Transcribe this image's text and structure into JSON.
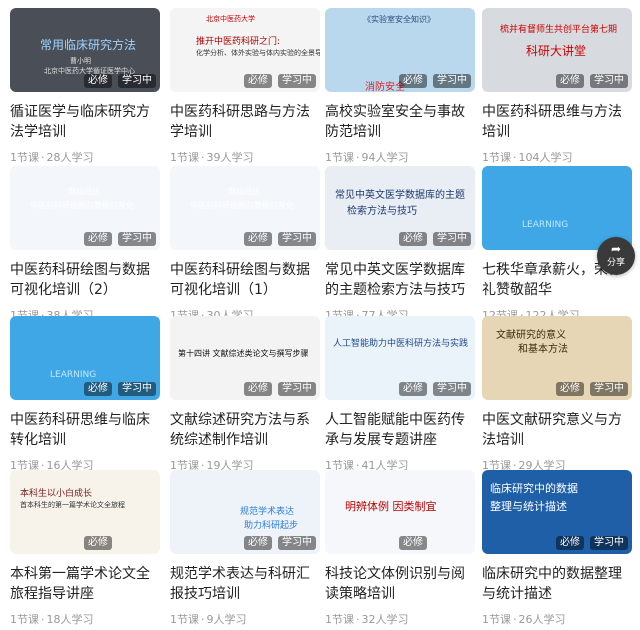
{
  "badges": {
    "required": "必修",
    "studying": "学习中"
  },
  "cards": [
    {
      "title": "循证医学与临床研究方法学培训",
      "lessons": "1节课",
      "learners": "28人学习",
      "thumb": {
        "bg": "#4a4f57",
        "lines": [
          "常用临床研究方法",
          "曹小明",
          "北京中医药大学循证医学中心"
        ]
      }
    },
    {
      "title": "中医药科研思路与方法学培训",
      "lessons": "1节课",
      "learners": "39人学习",
      "thumb": {
        "bg": "#f4f4f4",
        "lines": [
          "北京中医药大学",
          "推开中医药科研之门:",
          "化学分析、体外实验与体内实验的全景导览"
        ]
      }
    },
    {
      "title": "高校实验室安全与事故防范培训",
      "lessons": "1节课",
      "learners": "94人学习",
      "thumb": {
        "bg": "#b9d8ee",
        "lines": [
          "《实验室安全知识》",
          "消防安全"
        ]
      }
    },
    {
      "title": "中医药科研思维与方法培训",
      "lessons": "1节课",
      "learners": "104人学习",
      "thumb": {
        "bg": "#d7dbe0",
        "lines": [
          "梳并有督师生共创平台第七期",
          "科研大讲堂"
        ]
      }
    },
    {
      "title": "中医药科研绘图与数据可视化培训（2）",
      "lessons": "1节课",
      "learners": "38人学习",
      "thumb": {
        "bg": "#f3f6fb",
        "lines": [
          "数绘经纬",
          "中医药科研绘图与数据可视化"
        ]
      }
    },
    {
      "title": "中医药科研绘图与数据可视化培训（1）",
      "lessons": "1节课",
      "learners": "30人学习",
      "thumb": {
        "bg": "#f3f6fb",
        "lines": [
          "数绘经纬",
          "中医药科研绘图与数据可视化"
        ]
      }
    },
    {
      "title": "常见中英文医学数据库的主题检索方法与技巧",
      "lessons": "1节课",
      "learners": "77人学习",
      "thumb": {
        "bg": "#e9edf4",
        "lines": [
          "常见中英文医学数据库的主题",
          "检索方法与技巧"
        ]
      }
    },
    {
      "title": "七秩华章承薪火，荣休礼赞敬韶华",
      "lessons": "12节课",
      "learners": "122人学习",
      "thumb": {
        "bg": "#3fa7e6",
        "lines": [
          "LEARNING"
        ]
      }
    },
    {
      "title": "中医药科研思维与临床转化培训",
      "lessons": "1节课",
      "learners": "16人学习",
      "thumb": {
        "bg": "#3fa7e6",
        "lines": [
          "LEARNING"
        ]
      }
    },
    {
      "title": "文献综述研究方法与系统综述制作培训",
      "lessons": "1节课",
      "learners": "19人学习",
      "thumb": {
        "bg": "#f3f3f3",
        "lines": [
          "第十四讲  文献综述类论文与撰写步骤"
        ]
      }
    },
    {
      "title": "人工智能赋能中医药传承与发展专题讲座",
      "lessons": "1节课",
      "learners": "41人学习",
      "thumb": {
        "bg": "#eaf2fa",
        "lines": [
          "人工智能助力中医科研方法与实践"
        ]
      }
    },
    {
      "title": "中医文献研究意义与方法培训",
      "lessons": "1节课",
      "learners": "29人学习",
      "thumb": {
        "bg": "#e6d6b5",
        "lines": [
          "文献研究的意义",
          "和基本方法"
        ]
      }
    },
    {
      "title": "本科第一篇学术论文全旅程指导讲座",
      "lessons": "1节课",
      "learners": "18人学习",
      "thumb": {
        "bg": "#f7f3ea",
        "lines": [
          "本科生以小白成长",
          "首本科生的第一篇学术论文全旅程"
        ]
      }
    },
    {
      "title": "规范学术表达与科研汇报技巧培训",
      "lessons": "1节课",
      "learners": "9人学习",
      "thumb": {
        "bg": "#eef3f9",
        "lines": [
          "规范学术表达",
          "助力科研起步"
        ]
      }
    },
    {
      "title": "科技论文体例识别与阅读策略培训",
      "lessons": "1节课",
      "learners": "32人学习",
      "thumb": {
        "bg": "#f5f7fa",
        "lines": [
          "明辨体例  因类制宜"
        ]
      }
    },
    {
      "title": "临床研究中的数据整理与统计描述",
      "lessons": "1节课",
      "learners": "26人学习",
      "thumb": {
        "bg": "#1f5fa8",
        "lines": [
          "临床研究中的数据",
          "整理与统计描述"
        ]
      }
    }
  ],
  "share": {
    "label": "分享"
  }
}
